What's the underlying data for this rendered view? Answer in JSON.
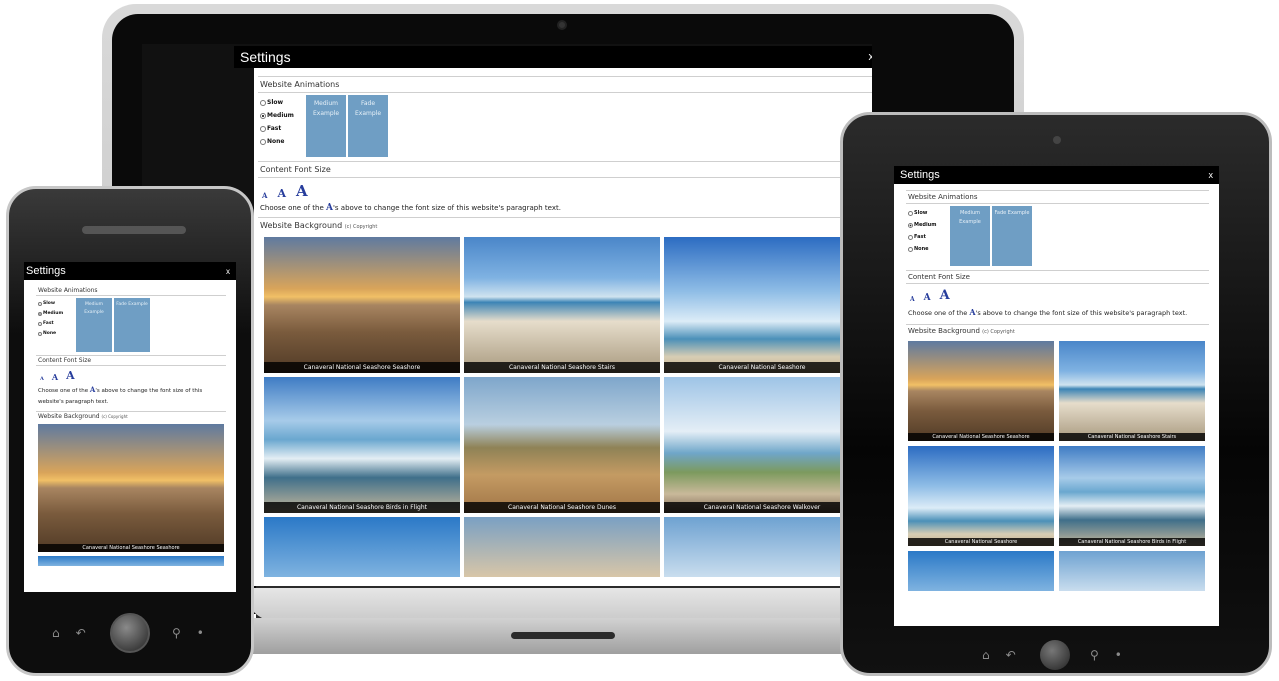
{
  "settings": {
    "title": "Settings",
    "close": "x",
    "animations": {
      "title": "Website Animations",
      "options": [
        "Slow",
        "Medium",
        "Fast",
        "None"
      ],
      "selected": "Medium",
      "example1": "Medium Example",
      "example2": "Fade Example"
    },
    "font": {
      "title": "Content Font Size",
      "sizes": [
        "A",
        "A",
        "A"
      ],
      "hint_before": "Choose one of the",
      "hint_glyph": "A",
      "hint_after": "'s above to change the font size of this website's paragraph text."
    },
    "background": {
      "title": "Website Background",
      "copyright": "(c) Copyright"
    },
    "photos": [
      {
        "caption": "Canaveral National Seashore Seashore",
        "style": "sunrise"
      },
      {
        "caption": "Canaveral National Seashore Stairs",
        "style": "stairs"
      },
      {
        "caption": "Canaveral National Seashore",
        "style": "sky"
      },
      {
        "caption": "Canaveral National Seashore Birds in Flight",
        "style": "birds"
      },
      {
        "caption": "Canaveral National Seashore Dunes",
        "style": "dunes"
      },
      {
        "caption": "Canaveral National Seashore Walkover",
        "style": "boardwalk"
      }
    ]
  }
}
